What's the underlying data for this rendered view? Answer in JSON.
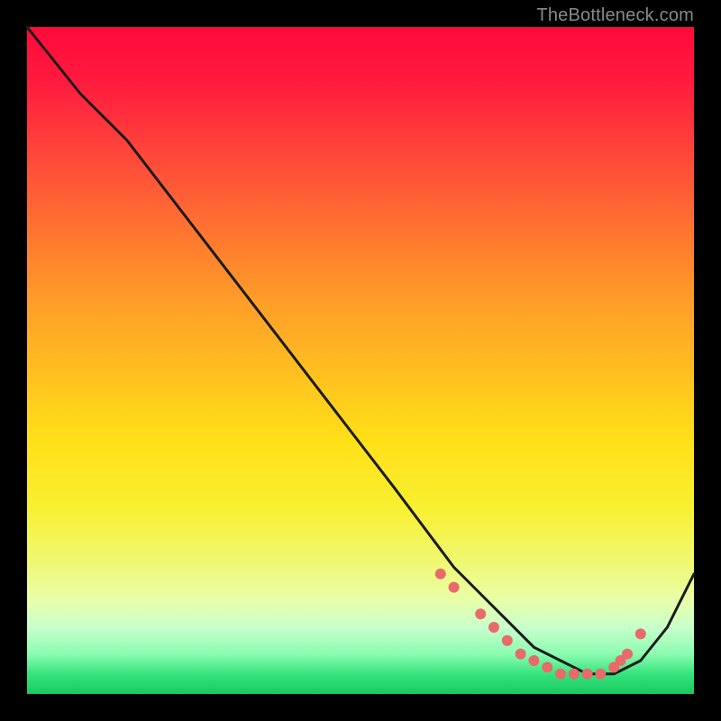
{
  "watermark": "TheBottleneck.com",
  "chart_data": {
    "type": "line",
    "title": "",
    "xlabel": "",
    "ylabel": "",
    "xlim": [
      0,
      100
    ],
    "ylim": [
      0,
      100
    ],
    "series": [
      {
        "name": "bottleneck-curve",
        "x": [
          0,
          8,
          15,
          25,
          35,
          45,
          55,
          61,
          64,
          68,
          72,
          76,
          80,
          84,
          88,
          92,
          96,
          100
        ],
        "y": [
          100,
          90,
          83,
          70,
          57,
          44,
          31,
          23,
          19,
          15,
          11,
          7,
          5,
          3,
          3,
          5,
          10,
          18
        ]
      }
    ],
    "markers": {
      "name": "highlight-dots",
      "x": [
        62,
        64,
        68,
        70,
        72,
        74,
        76,
        78,
        80,
        82,
        84,
        86,
        88,
        89,
        90,
        92
      ],
      "y": [
        18,
        16,
        12,
        10,
        8,
        6,
        5,
        4,
        3,
        3,
        3,
        3,
        4,
        5,
        6,
        9
      ],
      "color": "#e86a6a",
      "size": 6
    },
    "gradient_stops": [
      {
        "pos": 0.0,
        "color": "#ff0a3a"
      },
      {
        "pos": 0.2,
        "color": "#ff4a3a"
      },
      {
        "pos": 0.42,
        "color": "#ffa028"
      },
      {
        "pos": 0.62,
        "color": "#ffe018"
      },
      {
        "pos": 0.8,
        "color": "#f0f870"
      },
      {
        "pos": 0.94,
        "color": "#8cfcb0"
      },
      {
        "pos": 1.0,
        "color": "#18c860"
      }
    ]
  }
}
